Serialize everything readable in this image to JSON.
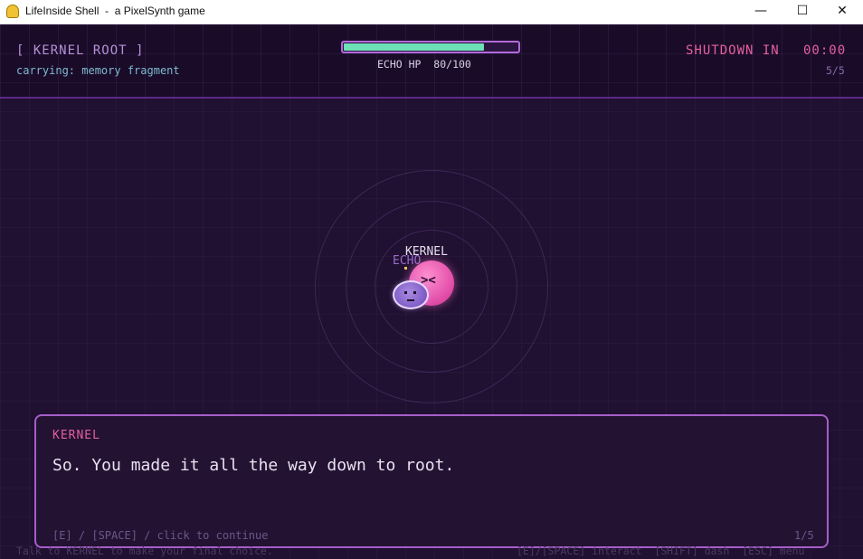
{
  "window": {
    "title": "LifeInside Shell  -  a PixelSynth game",
    "minimize": "—",
    "maximize": "☐",
    "close": "✕"
  },
  "hud": {
    "location": "[ KERNEL ROOT ]",
    "carrying": "carrying: memory fragment",
    "hp_label": "ECHO HP  80/100",
    "hp_fraction": 0.8,
    "shutdown_label": "SHUTDOWN IN",
    "shutdown_time": "00:00",
    "progress": "5/5"
  },
  "scene": {
    "kernel_label": "KERNEL",
    "echo_label": "ECHO",
    "kernel_face": "><"
  },
  "dialog": {
    "speaker": "KERNEL",
    "text": "So. You made it all the way down to root.",
    "hint": "[E] / [SPACE] / click to continue",
    "page": "1/5"
  },
  "footer": {
    "objective": "Talk to KERNEL to make your final choice.",
    "controls": "[E]/[SPACE] interact  [SHIFT] dash  [ESC] menu"
  },
  "colors": {
    "accent_pink": "#e4609f",
    "accent_purple": "#a55ec9",
    "hp_green": "#6ee0b6",
    "hud_cyan": "#7fb9cf"
  }
}
